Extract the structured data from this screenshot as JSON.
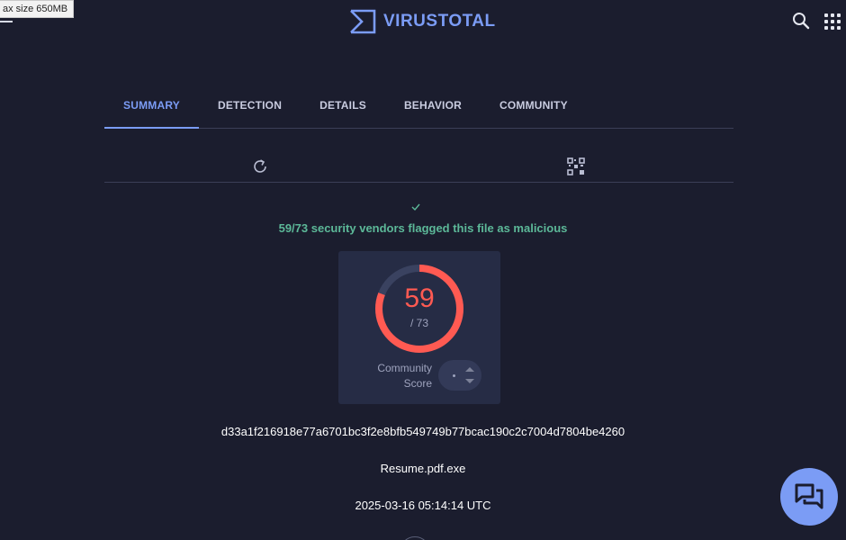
{
  "tooltip": {
    "text": "ax size 650MB"
  },
  "header": {
    "brand": "VIRUSTOTAL"
  },
  "tabs": [
    {
      "label": "SUMMARY"
    },
    {
      "label": "DETECTION"
    },
    {
      "label": "DETAILS"
    },
    {
      "label": "BEHAVIOR"
    },
    {
      "label": "COMMUNITY"
    }
  ],
  "active_tab": "SUMMARY",
  "verdict": {
    "text": "59/73 security vendors flagged this file as malicious"
  },
  "score": {
    "detections": "59",
    "total": "/ 73",
    "community_label_1": "Community",
    "community_label_2": "Score"
  },
  "file": {
    "hash": "d33a1f216918e77a6701bc3f2e8bfb549749b77bcac190c2c7004d7804be4260",
    "name": "Resume.pdf.exe",
    "date": "2025-03-16 05:14:14 UTC"
  },
  "colors": {
    "accent": "#7b9cf5",
    "malicious": "#ff5a52",
    "verdict": "#5cb898",
    "background": "#1b1d2e",
    "card": "#262c45"
  },
  "icons": {
    "menu": "hamburger-menu-icon",
    "logo": "virustotal-logo-icon",
    "search": "search-icon",
    "apps": "apps-grid-icon",
    "reload": "reload-icon",
    "qr": "qr-code-icon",
    "check": "check-icon",
    "chat": "chat-icon"
  }
}
